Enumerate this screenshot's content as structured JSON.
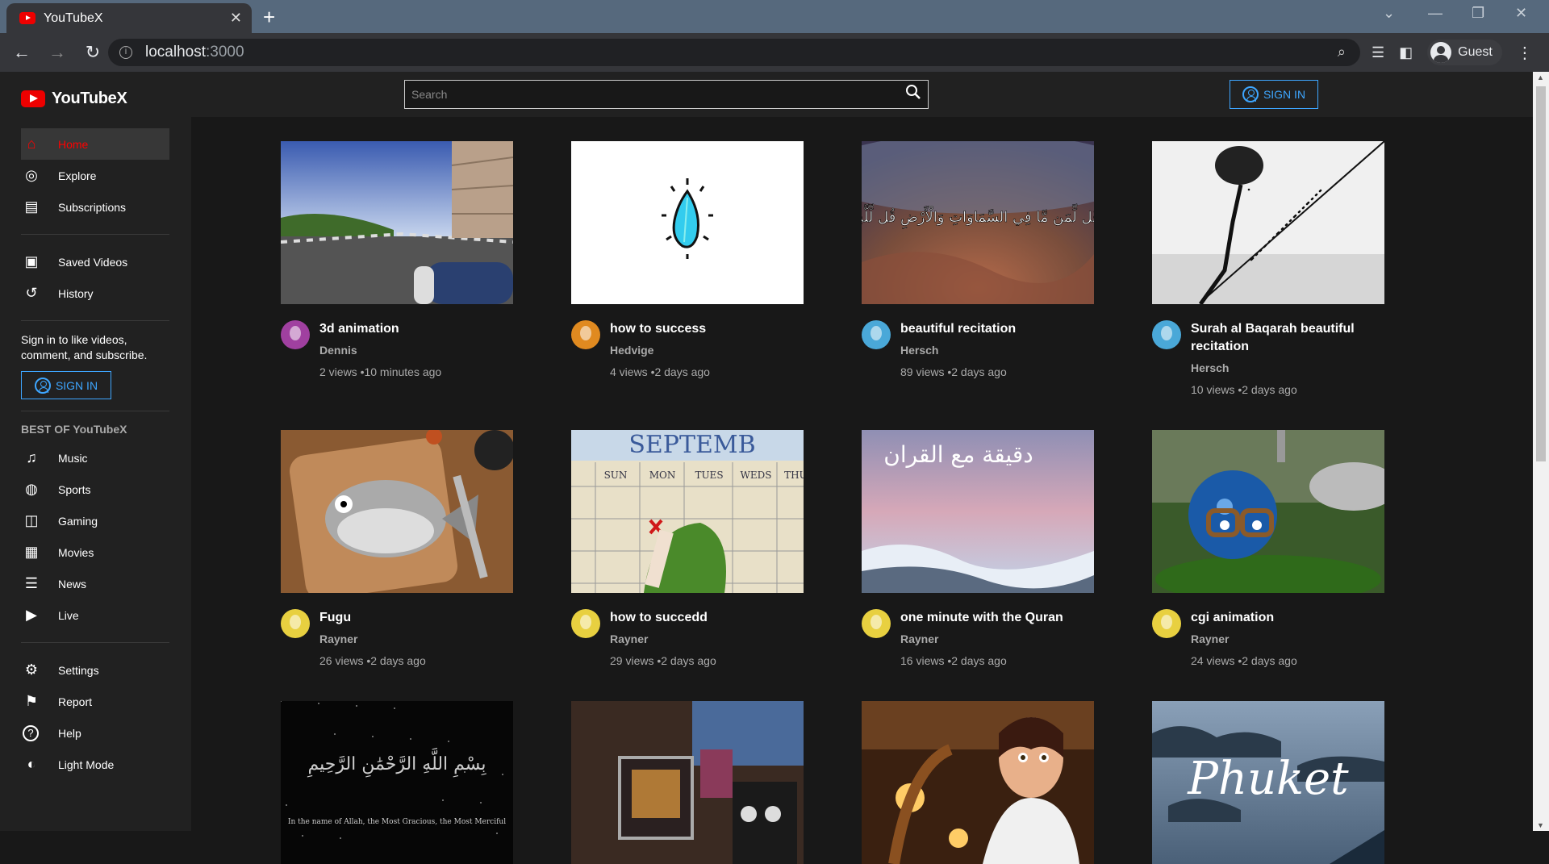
{
  "browser": {
    "tab_title": "YouTubeX",
    "url_host": "localhost",
    "url_port": ":3000",
    "profile": "Guest"
  },
  "app": {
    "name": "YouTubeX",
    "search_placeholder": "Search",
    "signin_label": "SIGN IN"
  },
  "sidebar": {
    "group1": [
      {
        "label": "Home",
        "icon": "home-icon",
        "active": true
      },
      {
        "label": "Explore",
        "icon": "compass-icon"
      },
      {
        "label": "Subscriptions",
        "icon": "subscriptions-icon"
      }
    ],
    "group2": [
      {
        "label": "Saved Videos",
        "icon": "saved-icon"
      },
      {
        "label": "History",
        "icon": "history-icon"
      }
    ],
    "signin_text": "Sign in to like videos, comment, and subscribe.",
    "signin_label": "SIGN IN",
    "best_heading": "BEST OF YouTubeX",
    "group3": [
      {
        "label": "Music",
        "icon": "music-icon"
      },
      {
        "label": "Sports",
        "icon": "sports-icon"
      },
      {
        "label": "Gaming",
        "icon": "gaming-icon"
      },
      {
        "label": "Movies",
        "icon": "movies-icon"
      },
      {
        "label": "News",
        "icon": "news-icon"
      },
      {
        "label": "Live",
        "icon": "live-icon"
      }
    ],
    "group4": [
      {
        "label": "Settings",
        "icon": "settings-icon"
      },
      {
        "label": "Report",
        "icon": "flag-icon"
      },
      {
        "label": "Help",
        "icon": "help-icon"
      },
      {
        "label": "Light Mode",
        "icon": "lightmode-icon"
      }
    ]
  },
  "videos": [
    {
      "title": "3d animation",
      "channel": "Dennis",
      "stats": "2 views •10 minutes ago",
      "thumb": "road-scene",
      "avatar_color": "#a040a0"
    },
    {
      "title": "how to success",
      "channel": "Hedvige",
      "stats": "4 views •2 days ago",
      "thumb": "white-gem",
      "avatar_color": "#e08a20"
    },
    {
      "title": "beautiful recitation",
      "channel": "Hersch",
      "stats": "89 views •2 days ago",
      "thumb": "earth-calligraphy",
      "avatar_color": "#4aa8d8"
    },
    {
      "title": "Surah al Baqarah beautiful recitation",
      "channel": "Hersch",
      "stats": "10 views •2 days ago",
      "thumb": "sketch",
      "avatar_color": "#4aa8d8"
    },
    {
      "title": "Fugu",
      "channel": "Rayner",
      "stats": "26 views •2 days ago",
      "thumb": "fish",
      "avatar_color": "#e8d040"
    },
    {
      "title": "how to succedd",
      "channel": "Rayner",
      "stats": "29 views •2 days ago",
      "thumb": "calendar",
      "avatar_color": "#e8d040"
    },
    {
      "title": "one minute with the Quran",
      "channel": "Rayner",
      "stats": "16 views •2 days ago",
      "thumb": "clouds",
      "avatar_color": "#e8d040"
    },
    {
      "title": "cgi animation",
      "channel": "Rayner",
      "stats": "24 views •2 days ago",
      "thumb": "blue-ball",
      "avatar_color": "#e8d040"
    },
    {
      "title": "",
      "channel": "",
      "stats": "",
      "thumb": "bismillah",
      "avatar_color": "#333"
    },
    {
      "title": "",
      "channel": "",
      "stats": "",
      "thumb": "kitchen",
      "avatar_color": "#333"
    },
    {
      "title": "",
      "channel": "",
      "stats": "",
      "thumb": "chef",
      "avatar_color": "#333"
    },
    {
      "title": "",
      "channel": "",
      "stats": "",
      "thumb": "phuket",
      "avatar_color": "#333"
    }
  ],
  "thumb_text": {
    "earth": "قُل لِّمَن مَّا فِي السَّمَاوَاتِ وَالْأَرْضِ قُل لِّلَّهِ",
    "clouds": "دقيقة مع القران",
    "bismillah": "بِسْمِ اللَّهِ الرَّحْمَٰنِ الرَّحِيمِ",
    "bismillah_sub": "In the name of Allah, the Most Gracious, the Most Merciful",
    "phuket": "Phuket",
    "calendar_month": "SEPTEMB",
    "calendar_days": [
      "SUN",
      "MON",
      "TUES",
      "WEDS",
      "THURS"
    ]
  }
}
